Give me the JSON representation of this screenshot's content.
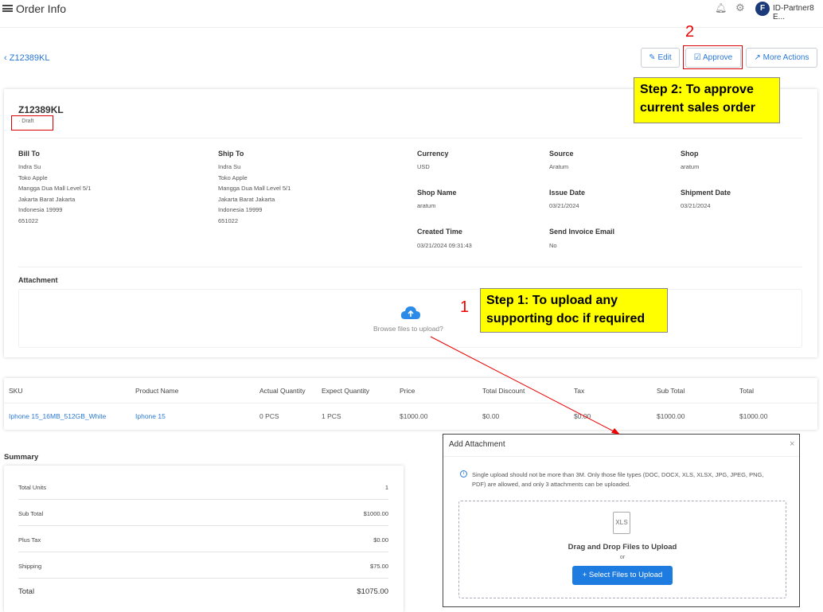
{
  "header": {
    "menu_icon": "menu-icon",
    "title": "Order Info",
    "user": "ID-Partner8 E...",
    "logo_letter": "F"
  },
  "order": {
    "back_label": "Z12389KL",
    "id": "Z12389KL",
    "status": "· Draft"
  },
  "actions": {
    "edit": "Edit",
    "approve": "Approve",
    "more": "More Actions"
  },
  "callouts": {
    "num2": "2",
    "step2": "Step 2: To approve current sales order",
    "num1": "1",
    "step1": "Step 1: To upload any supporting doc if required"
  },
  "bill_to": {
    "label": "Bill To",
    "lines": [
      "Indra Su",
      "Toko Apple",
      "Mangga Dua Mall Level 5/1",
      "Jakarta Barat Jakarta",
      "Indonesia 19999",
      "651022"
    ]
  },
  "ship_to": {
    "label": "Ship To",
    "lines": [
      "Indra Su",
      "Toko Apple",
      "Mangga Dua Mall Level 5/1",
      "Jakarta Barat Jakarta",
      "Indonesia 19999",
      "651022"
    ]
  },
  "fields": {
    "currency": {
      "label": "Currency",
      "value": "USD"
    },
    "source": {
      "label": "Source",
      "value": "Aratum"
    },
    "shop": {
      "label": "Shop",
      "value": "aratum"
    },
    "shop_name": {
      "label": "Shop Name",
      "value": "aratum"
    },
    "issue_date": {
      "label": "Issue Date",
      "value": "03/21/2024"
    },
    "shipment_date": {
      "label": "Shipment Date",
      "value": "03/21/2024"
    },
    "created_time": {
      "label": "Created Time",
      "value": "03/21/2024 09:31:43"
    },
    "send_invoice": {
      "label": "Send Invoice Email",
      "value": "No"
    }
  },
  "attachment": {
    "label": "Attachment",
    "browse": "Browse files to upload?"
  },
  "table": {
    "headers": [
      "SKU",
      "Product Name",
      "Actual Quantity",
      "Expect Quantity",
      "Price",
      "Total Discount",
      "Tax",
      "Sub Total",
      "Total"
    ],
    "row": [
      "Iphone 15_16MB_512GB_White",
      "Iphone 15",
      "0 PCS",
      "1 PCS",
      "$1000.00",
      "$0.00",
      "$0.00",
      "$1000.00",
      "$1000.00"
    ]
  },
  "summary": {
    "title": "Summary",
    "rows": [
      {
        "label": "Total Units",
        "value": "1"
      },
      {
        "label": "Sub Total",
        "value": "$1000.00"
      },
      {
        "label": "Plus Tax",
        "value": "$0.00"
      },
      {
        "label": "Shipping",
        "value": "$75.00"
      },
      {
        "label": "Total",
        "value": "$1075.00"
      }
    ]
  },
  "modal": {
    "title": "Add Attachment",
    "close": "×",
    "info": "Single upload should not be more than 3M. Only those file types (DOC, DOCX, XLS, XLSX, JPG, JPEG, PNG, PDF) are allowed, and only 3 attachments can be uploaded.",
    "file_icon_text": "XLS",
    "drag": "Drag and Drop Files to Upload",
    "or": "or",
    "select": "+ Select Files to Upload"
  },
  "colors": {
    "accent": "#2a78d6",
    "callout": "#ffff00",
    "annotation": "#dd0000"
  }
}
